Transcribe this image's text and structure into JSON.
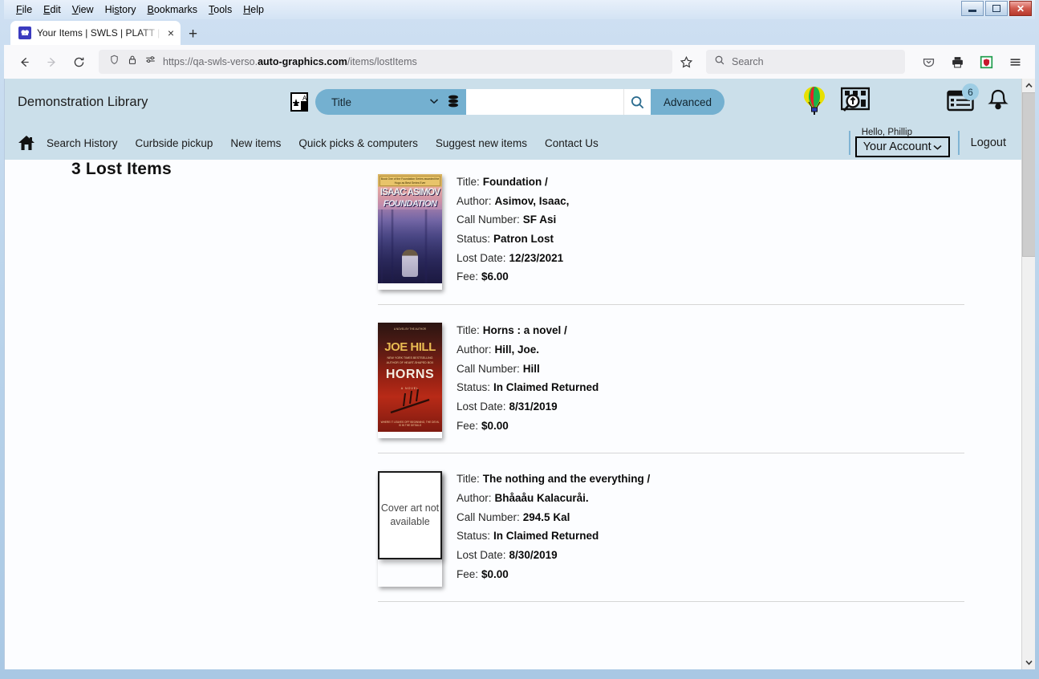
{
  "browser": {
    "menus": [
      "File",
      "Edit",
      "View",
      "History",
      "Bookmarks",
      "Tools",
      "Help"
    ],
    "tab_title": "Your Items | SWLS | PLATT | Aut",
    "tab_close": "×",
    "new_tab": "+",
    "url_prefix": "https://qa-swls-verso.",
    "url_domain": "auto-graphics.com",
    "url_suffix": "/items/lostItems",
    "search_placeholder": "Search",
    "window_controls": {
      "minimize": "minimize",
      "maximize": "restore",
      "close": "✕"
    }
  },
  "site": {
    "library_name": "Demonstration Library",
    "search_scope": "Title",
    "search_value": "",
    "advanced_label": "Advanced",
    "notification_count": "6",
    "nav_links": [
      "Search History",
      "Curbside pickup",
      "New items",
      "Quick picks & computers",
      "Suggest new items",
      "Contact Us"
    ],
    "greeting": "Hello, Phillip",
    "account_label": "Your Account",
    "account_caret": "⌄",
    "logout_label": "Logout"
  },
  "page": {
    "title": "3 Lost Items",
    "field_labels": {
      "title": "Title:",
      "author": "Author:",
      "call_number": "Call Number:",
      "status": "Status:",
      "lost_date": "Lost Date:",
      "fee": "Fee:"
    },
    "no_cover_text": "Cover art not available",
    "items": [
      {
        "title": "Foundation /",
        "author": "Asimov, Isaac,",
        "call_number": "SF Asi",
        "status": "Patron Lost",
        "lost_date": "12/23/2021",
        "fee": "$6.00",
        "cover": "foundation",
        "cover_band": "Book One of the Foundation Series awarded the Hugo as Best Series Ever",
        "cover_author": "ISAAC ASIMOV",
        "cover_title": "FOUNDATION"
      },
      {
        "title": "Horns : a novel /",
        "author": "Hill, Joe.",
        "call_number": "Hill",
        "status": "In Claimed Returned",
        "lost_date": "8/31/2019",
        "fee": "$0.00",
        "cover": "horns",
        "cover_top": "A NOVEL BY THE AUTHOR",
        "cover_author": "JOE HILL",
        "cover_blurb": "NEW YORK TIMES BESTSELLING AUTHOR OF HEART-SHAPED BOX",
        "cover_title": "HORNS",
        "cover_sub": "A NOVEL",
        "cover_footer": "WHERE IT LEAVES OFF BEGINNING, THE DEVIL IS IN THE DETAILS"
      },
      {
        "title": "The nothing and the everything /",
        "author": "Bhåaåu Kalacuråi.",
        "call_number": "294.5 Kal",
        "status": "In Claimed Returned",
        "lost_date": "8/30/2019",
        "fee": "$0.00",
        "cover": "none"
      }
    ]
  },
  "colors": {
    "header_bg": "#cbdfea",
    "accent": "#74b0d0",
    "badge": "#9ecde4"
  }
}
